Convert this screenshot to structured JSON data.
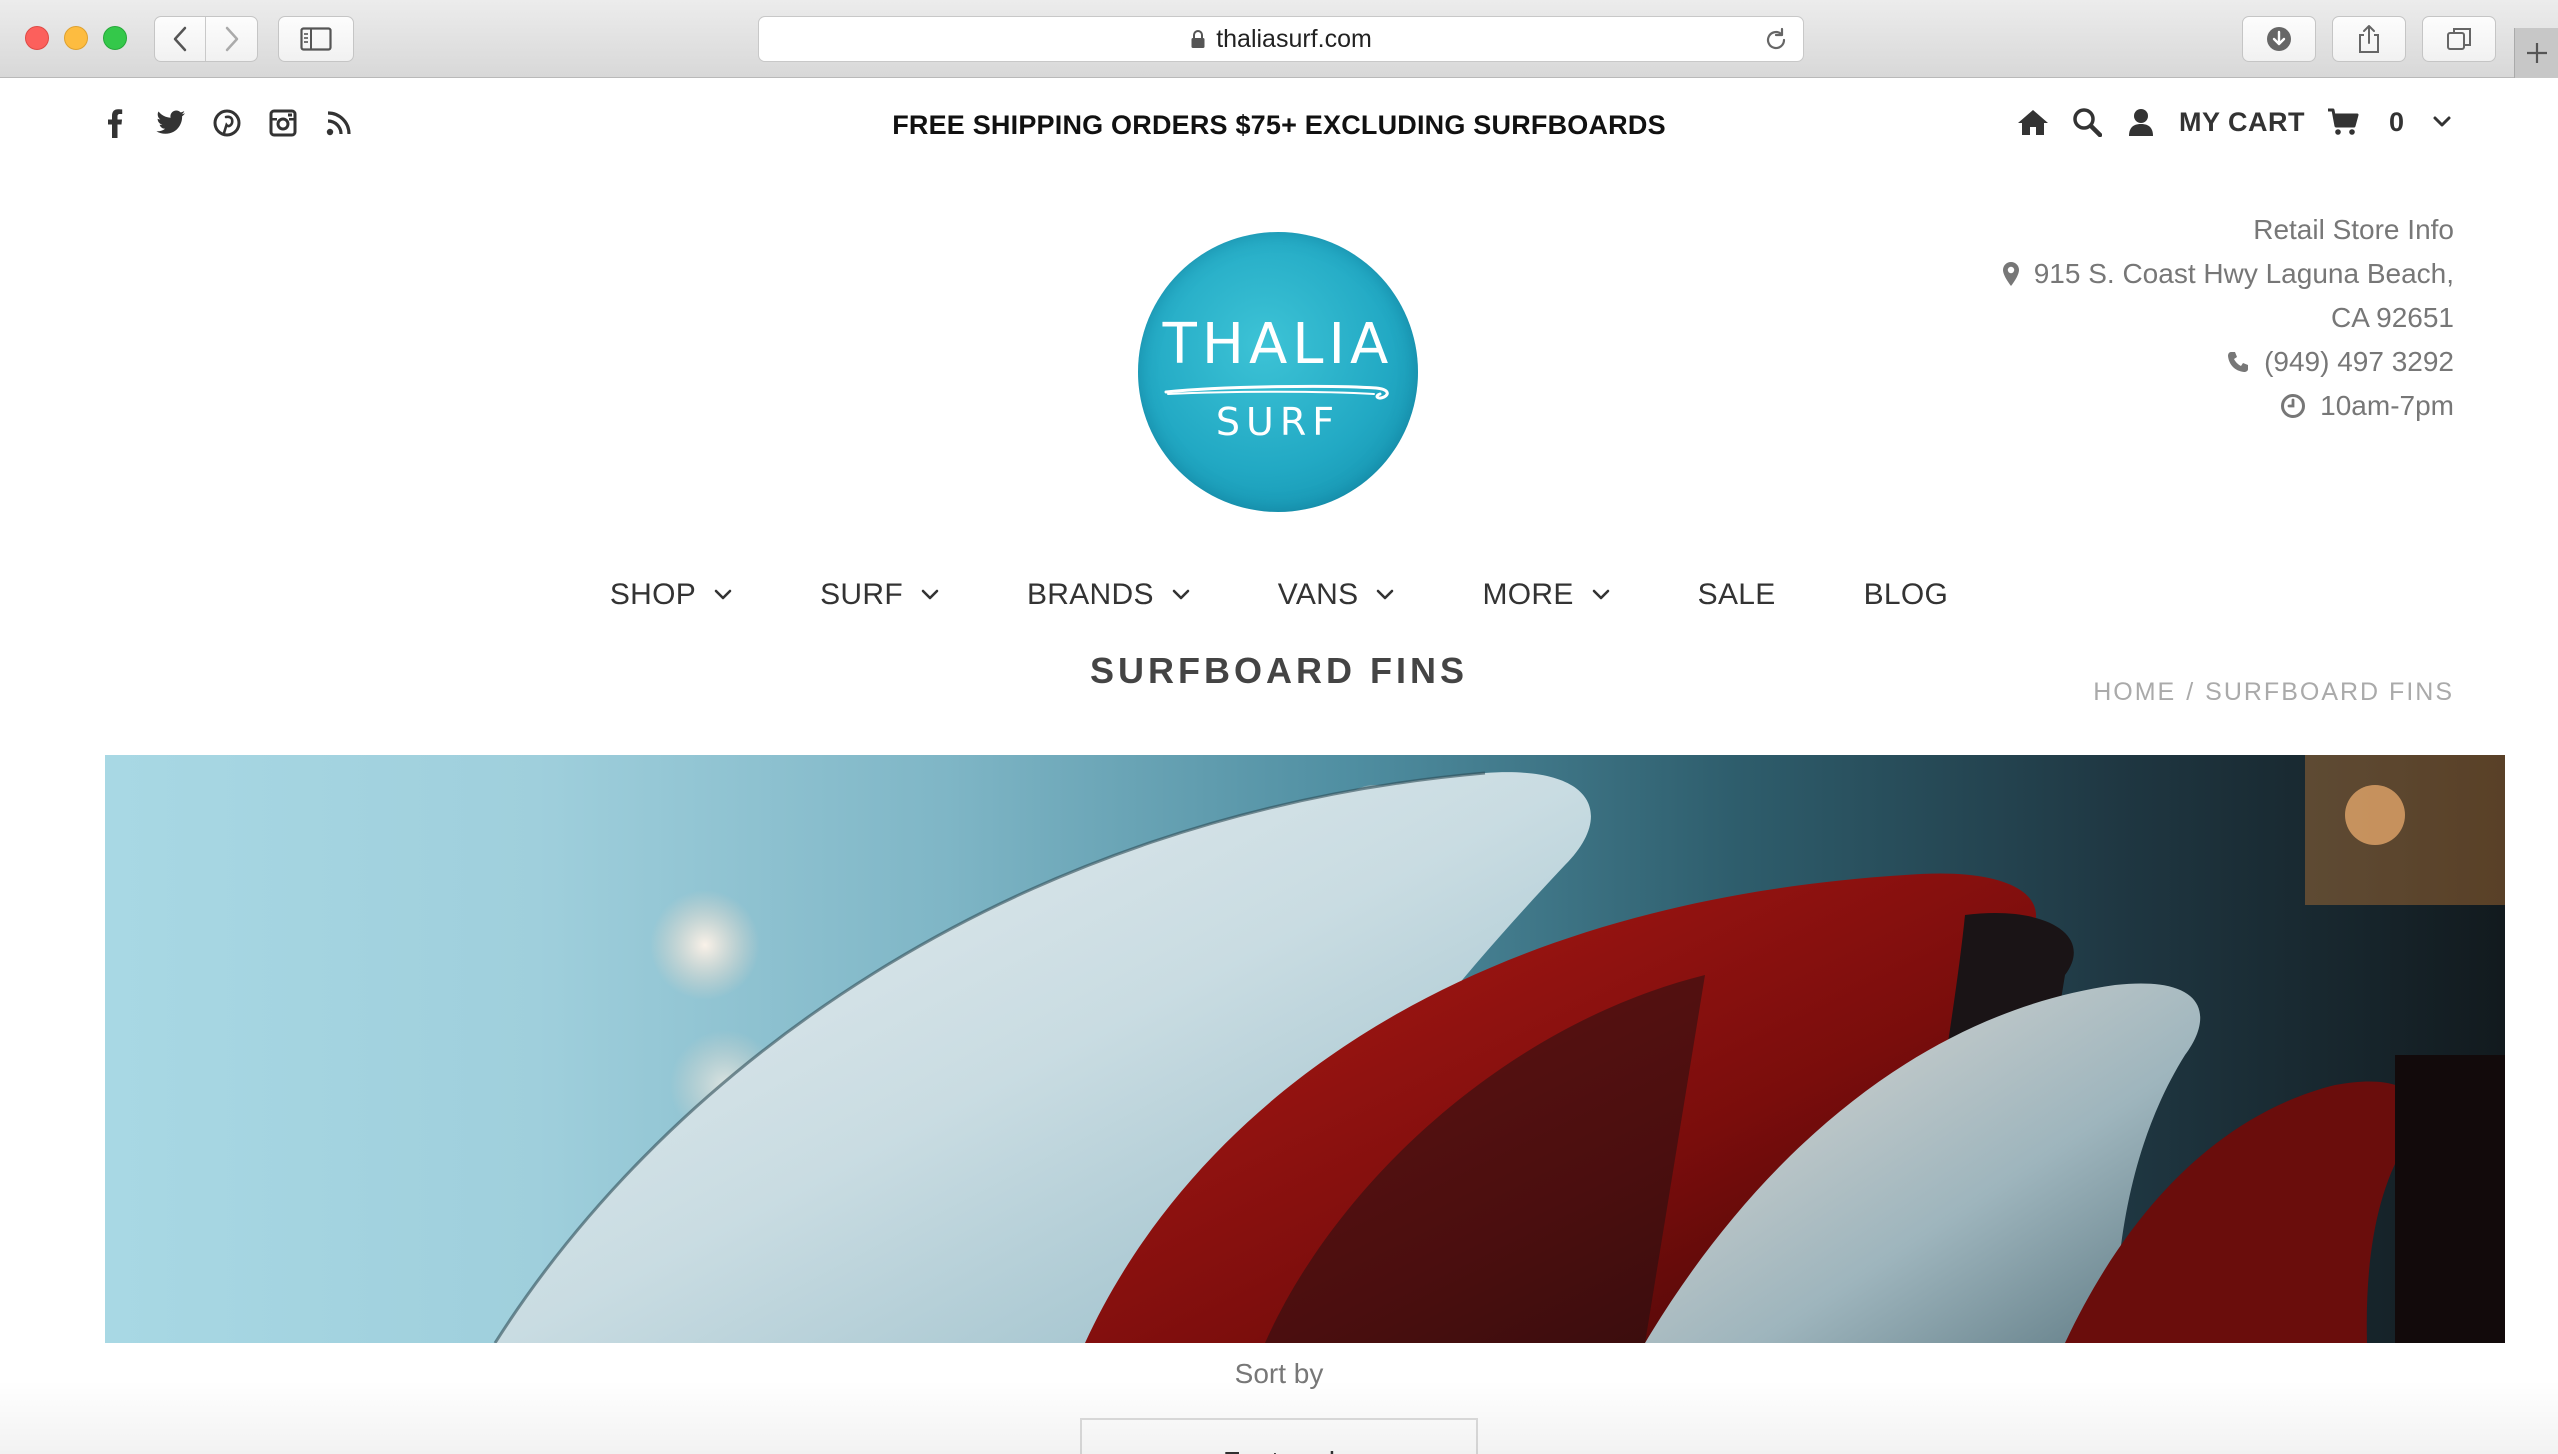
{
  "browser": {
    "url": "thaliasurf.com",
    "icons": [
      "close",
      "minimize",
      "maximize",
      "back-arrow",
      "forward-arrow",
      "sidebar",
      "lock",
      "reload",
      "download",
      "share",
      "tabs",
      "plus"
    ]
  },
  "topbar": {
    "promo": "FREE SHIPPING ORDERS $75+ EXCLUDING SURFBOARDS",
    "social_icons": [
      "facebook",
      "twitter",
      "pinterest",
      "instagram",
      "rss"
    ],
    "cart_label": "MY CART",
    "cart_count": "0"
  },
  "store_info": {
    "heading": "Retail Store Info",
    "address_line1": "915 S. Coast Hwy Laguna Beach,",
    "address_line2": "CA 92651",
    "phone": "(949) 497 3292",
    "hours": "10am-7pm"
  },
  "logo": {
    "title": "THALIA",
    "subtitle": "SURF",
    "color": "#26b0c8"
  },
  "nav": {
    "items": [
      {
        "label": "SHOP"
      },
      {
        "label": "SURF"
      },
      {
        "label": "BRANDS"
      },
      {
        "label": "VANS"
      },
      {
        "label": "MORE"
      },
      {
        "label": "SALE"
      },
      {
        "label": "BLOG"
      }
    ]
  },
  "page": {
    "title": "SURFBOARD FINS",
    "breadcrumb_home": "HOME",
    "breadcrumb_sep": "/",
    "breadcrumb_current": "SURFBOARD FINS"
  },
  "sort": {
    "label": "Sort by",
    "selected": "Featured"
  }
}
